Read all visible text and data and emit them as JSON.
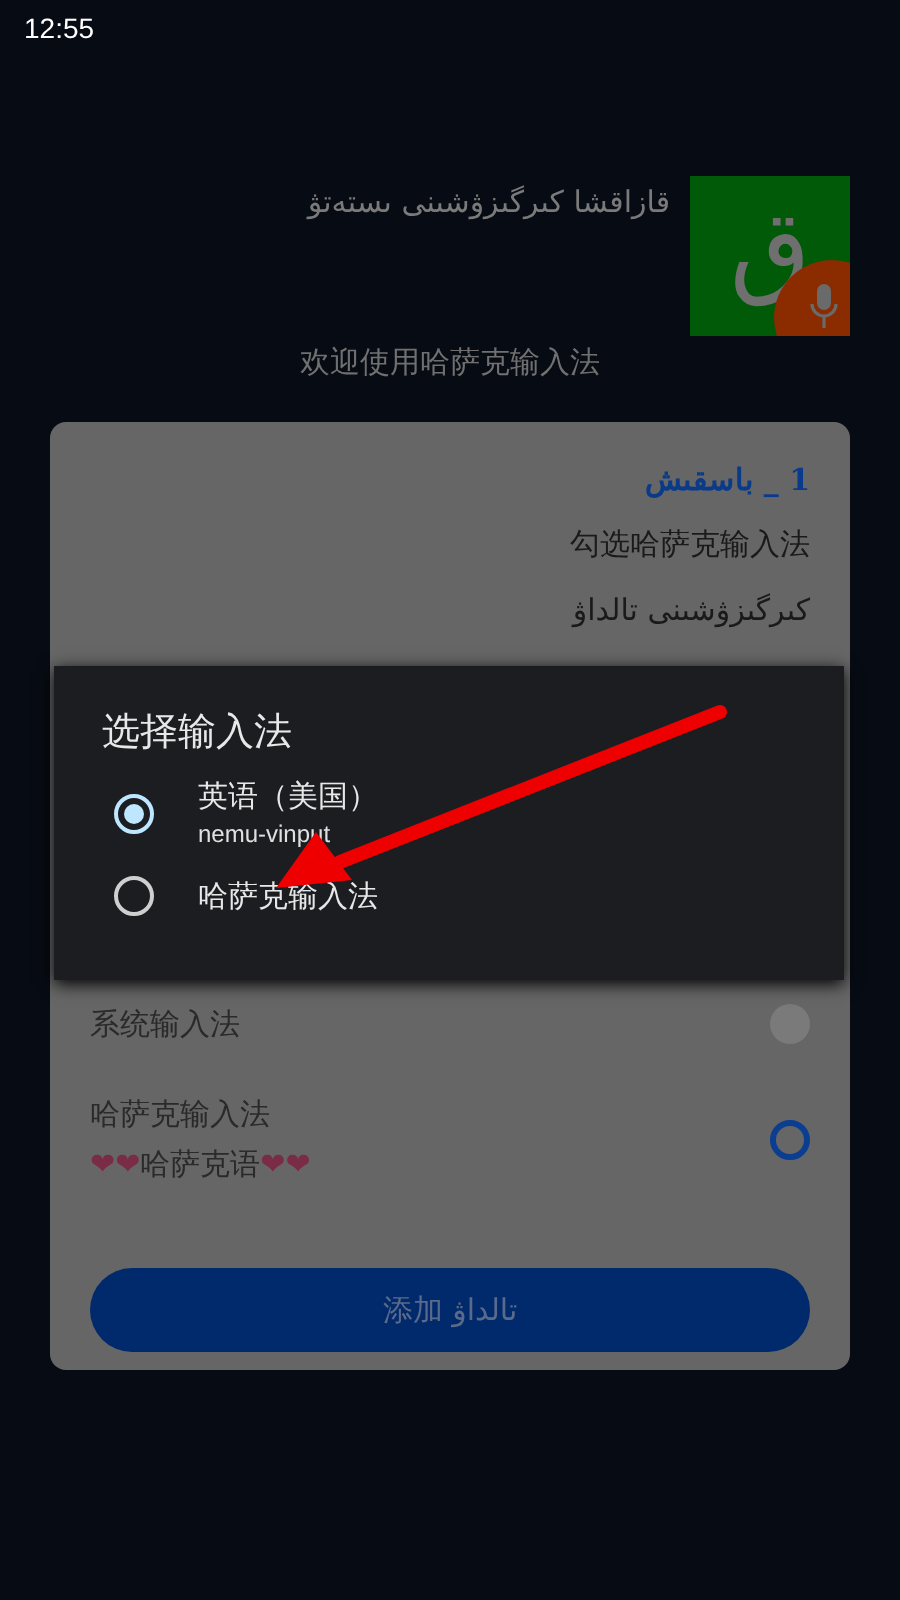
{
  "status_bar": {
    "time": "12:55"
  },
  "header": {
    "title": "قازاقشا كىرگىزۋشىنى ىستەتۋ",
    "logo": {
      "glyph": "ق"
    },
    "welcome": "欢迎使用哈萨克输入法"
  },
  "card": {
    "step_title": "1 _ باسقىش",
    "step_text": "勾选哈萨克输入法",
    "step_hint": "كىرگىزۋشىنى تالداۋ",
    "methods": [
      {
        "title": "系统输入法",
        "selected": true,
        "disabled": true
      },
      {
        "title": "哈萨克输入法",
        "subtitle_parts": [
          {
            "kind": "emoji",
            "text": "❤❤"
          },
          {
            "kind": "text",
            "text": "哈萨克语"
          },
          {
            "kind": "emoji",
            "text": "❤❤"
          }
        ],
        "selected": false,
        "disabled": false
      }
    ],
    "button": "添加 تالداۋ"
  },
  "dialog": {
    "title": "选择输入法",
    "options": [
      {
        "label": "英语（美国）",
        "sublabel": "nemu-vinput",
        "selected": true
      },
      {
        "label": "哈萨克输入法",
        "selected": false
      }
    ]
  }
}
